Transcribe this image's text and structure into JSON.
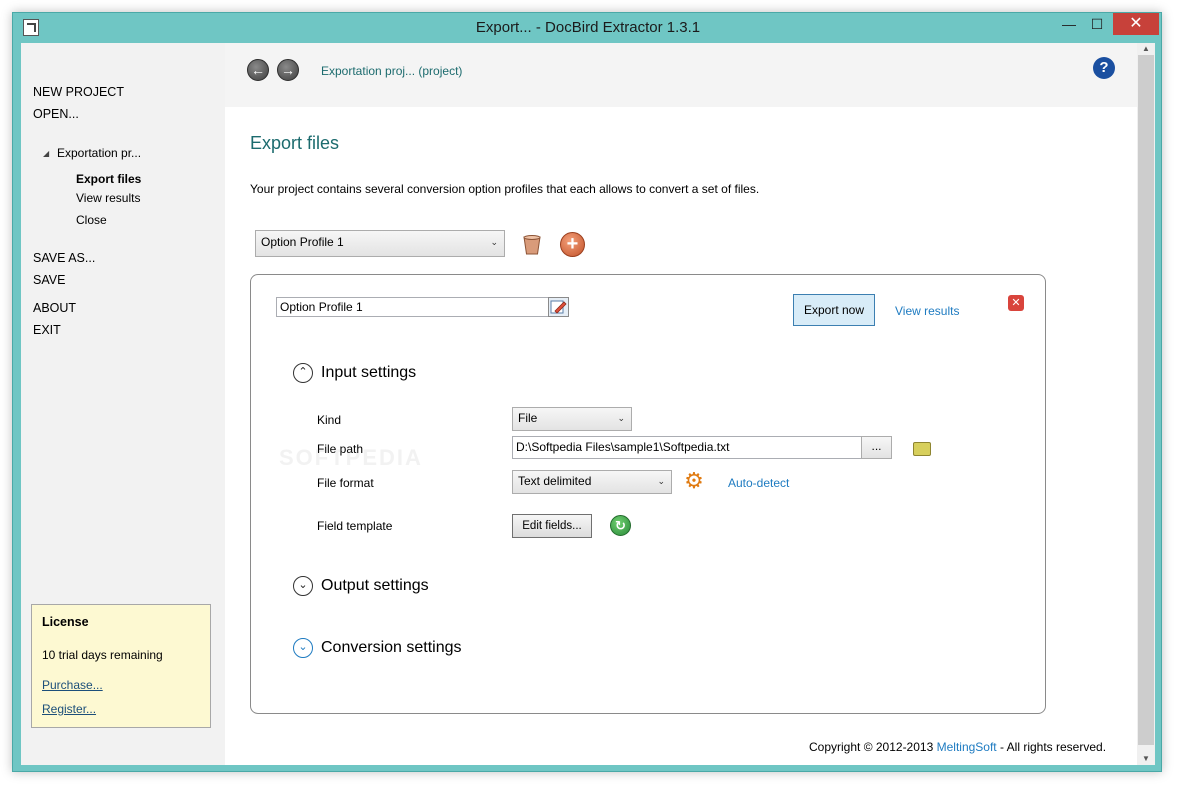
{
  "window": {
    "title": "Export... - DocBird Extractor 1.3.1",
    "controls": {
      "minimize": "—",
      "maximize": "☐",
      "close": "✕"
    }
  },
  "sidebar": {
    "items": [
      {
        "label": "NEW PROJECT"
      },
      {
        "label": "OPEN..."
      },
      {
        "label": "Exportation pr...",
        "expander": "◢"
      },
      {
        "label": "Export files",
        "selected": true
      },
      {
        "label": "View results"
      },
      {
        "label": "Close"
      },
      {
        "label": "SAVE AS..."
      },
      {
        "label": "SAVE"
      },
      {
        "label": "ABOUT"
      },
      {
        "label": "EXIT"
      }
    ],
    "license": {
      "title": "License",
      "status": "10 trial days remaining",
      "purchase": "Purchase...",
      "register": "Register..."
    }
  },
  "navbar": {
    "back": "←",
    "forward": "→",
    "breadcrumb": "Exportation proj... (project)",
    "help": "?"
  },
  "page": {
    "heading": "Export files",
    "description": "Your project contains several conversion option profiles that each allows to convert a set of files.",
    "profile_select": "Option Profile 1",
    "dropdown_arrow": "⌄"
  },
  "panel": {
    "profile_name": "Option Profile 1",
    "export_now": "Export now",
    "view_results": "View results",
    "close": "✕",
    "sections": {
      "input": {
        "title": "Input settings",
        "icon": "⌃"
      },
      "output": {
        "title": "Output settings",
        "icon": "⌄"
      },
      "conversion": {
        "title": "Conversion settings",
        "icon": "⌄"
      }
    },
    "fields": {
      "kind_label": "Kind",
      "kind_value": "File",
      "file_path_label": "File path",
      "file_path_value": "D:\\Softpedia Files\\sample1\\Softpedia.txt",
      "browse": "...",
      "file_format_label": "File format",
      "file_format_value": "Text delimited",
      "auto_detect": "Auto-detect",
      "field_template_label": "Field template",
      "edit_fields": "Edit fields...",
      "gear": "⚙",
      "refresh": "↻"
    }
  },
  "footer": {
    "prefix": "Copyright © 2012-2013",
    "brand": "MeltingSoft",
    "suffix": "- All rights reserved."
  },
  "watermark": "SOFTPEDIA",
  "colors": {
    "title_bar": "#6fc6c4",
    "accent_text": "#1c6b6e",
    "link": "#1e7bc1",
    "license_bg": "#fdf9d2",
    "close_button": "#c7413a"
  }
}
